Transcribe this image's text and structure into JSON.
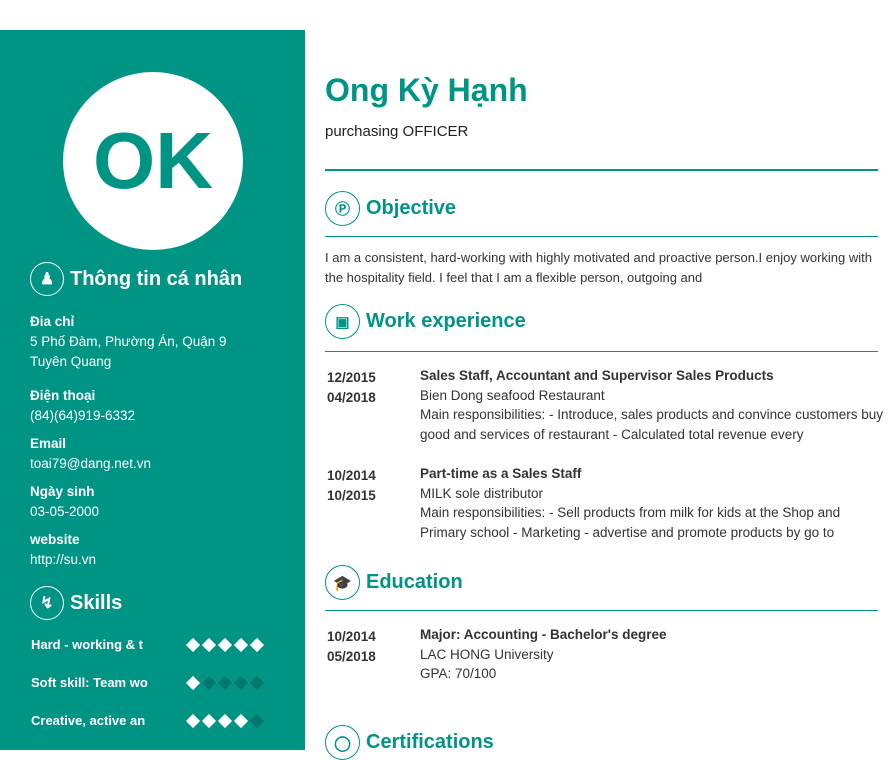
{
  "profile": {
    "initials": "OK",
    "name": "Ong Kỳ Hạnh",
    "role": "purchasing OFFICER"
  },
  "sidebar": {
    "personal_heading": "Thông tin cá nhân",
    "fields": [
      {
        "label": "Đia chỉ",
        "value": "5 Phố Đàm, Phường Án, Quận 9",
        "value2": "Tuyên Quang"
      },
      {
        "label": "Điện thoại",
        "value": "(84)(64)919-6332"
      },
      {
        "label": "Email",
        "value": "toai79@dang.net.vn"
      },
      {
        "label": "Ngày sinh",
        "value": "03-05-2000"
      },
      {
        "label": "website",
        "value": "http://su.vn"
      }
    ],
    "skills_heading": "Skills",
    "skills": [
      {
        "name": "Hard - working & t",
        "rating": 5
      },
      {
        "name": "Soft skill: Team wo",
        "rating": 1
      },
      {
        "name": "Creative, active an",
        "rating": 4
      }
    ]
  },
  "main": {
    "objective_heading": "Objective",
    "objective_text": "I am a consistent, hard-working with highly motivated and proactive person.I enjoy working with the hospitality field. I feel that I am a flexible person, outgoing and",
    "work_heading": "Work experience",
    "work": [
      {
        "start": "12/2015",
        "end": "04/2018",
        "title": "Sales Staff, Accountant and Supervisor Sales Products",
        "company": "Bien Dong seafood Restaurant",
        "desc": "Main responsibilities: - Introduce, sales products and convince customers buy good and services of restaurant - Calculated total revenue every"
      },
      {
        "start": "10/2014",
        "end": "10/2015",
        "title": "Part-time as a Sales Staff",
        "company": "MILK sole distributor",
        "desc": "Main responsibilities: - Sell products from milk for kids at the Shop and Primary school  - Marketing - advertise and promote products by go to"
      }
    ],
    "education_heading": "Education",
    "education": [
      {
        "start": "10/2014",
        "end": "05/2018",
        "title": "Major: Accounting - Bachelor's degree",
        "school": "LAC HONG University",
        "gpa": "GPA: 70/100"
      }
    ],
    "certifications_heading": "Certifications"
  },
  "colors": {
    "accent": "#009485"
  }
}
